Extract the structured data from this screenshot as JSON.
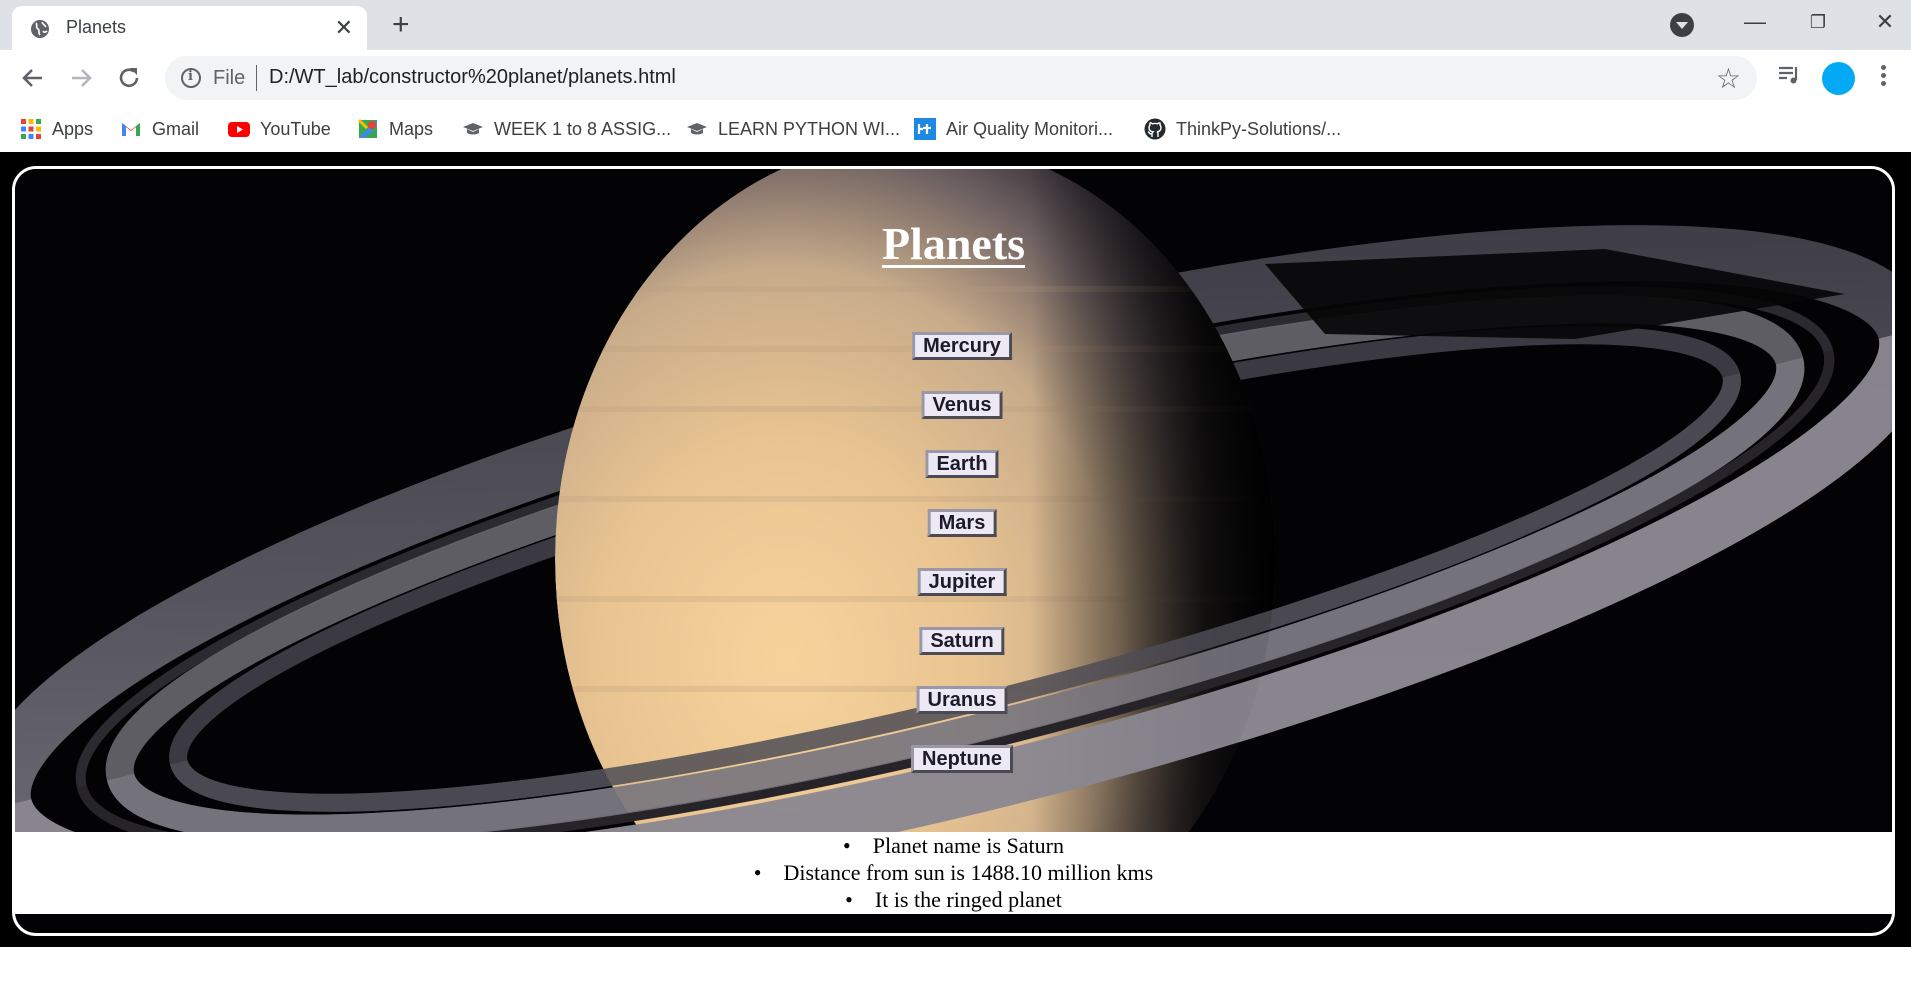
{
  "browser": {
    "tab": {
      "title": "Planets",
      "favicon": "globe-icon",
      "close_label": "✕"
    },
    "new_tab_label": "+",
    "window_controls": {
      "minimize": "—",
      "restore": "❐",
      "close": "✕"
    },
    "address": {
      "scheme": "File",
      "url": "D:/WT_lab/constructor%20planet/planets.html"
    },
    "bookmarks": [
      {
        "label": "Apps",
        "icon": "apps-grid-icon"
      },
      {
        "label": "Gmail",
        "icon": "gmail-icon"
      },
      {
        "label": "YouTube",
        "icon": "youtube-icon"
      },
      {
        "label": "Maps",
        "icon": "maps-icon"
      },
      {
        "label": "WEEK 1 to 8 ASSIG...",
        "icon": "graduation-cap-icon"
      },
      {
        "label": "LEARN PYTHON WI...",
        "icon": "graduation-cap-icon"
      },
      {
        "label": "Air Quality Monitori...",
        "icon": "air-quality-icon"
      },
      {
        "label": "ThinkPy-Solutions/...",
        "icon": "github-icon"
      }
    ],
    "colors": {
      "tabstrip": "#dee1e6",
      "avatar": "#03a9f4"
    }
  },
  "page": {
    "title": "Planets",
    "planets": [
      "Mercury",
      "Venus",
      "Earth",
      "Mars",
      "Jupiter",
      "Saturn",
      "Uranus",
      "Neptune"
    ],
    "info": [
      "Planet name is Saturn",
      "Distance from sun is 1488.10 million kms",
      "It is the ringed planet"
    ],
    "background_image": "saturn-with-rings",
    "colors": {
      "frame_border": "#ffffff",
      "button_bg": "#ece9f5",
      "text": "#000000"
    }
  }
}
